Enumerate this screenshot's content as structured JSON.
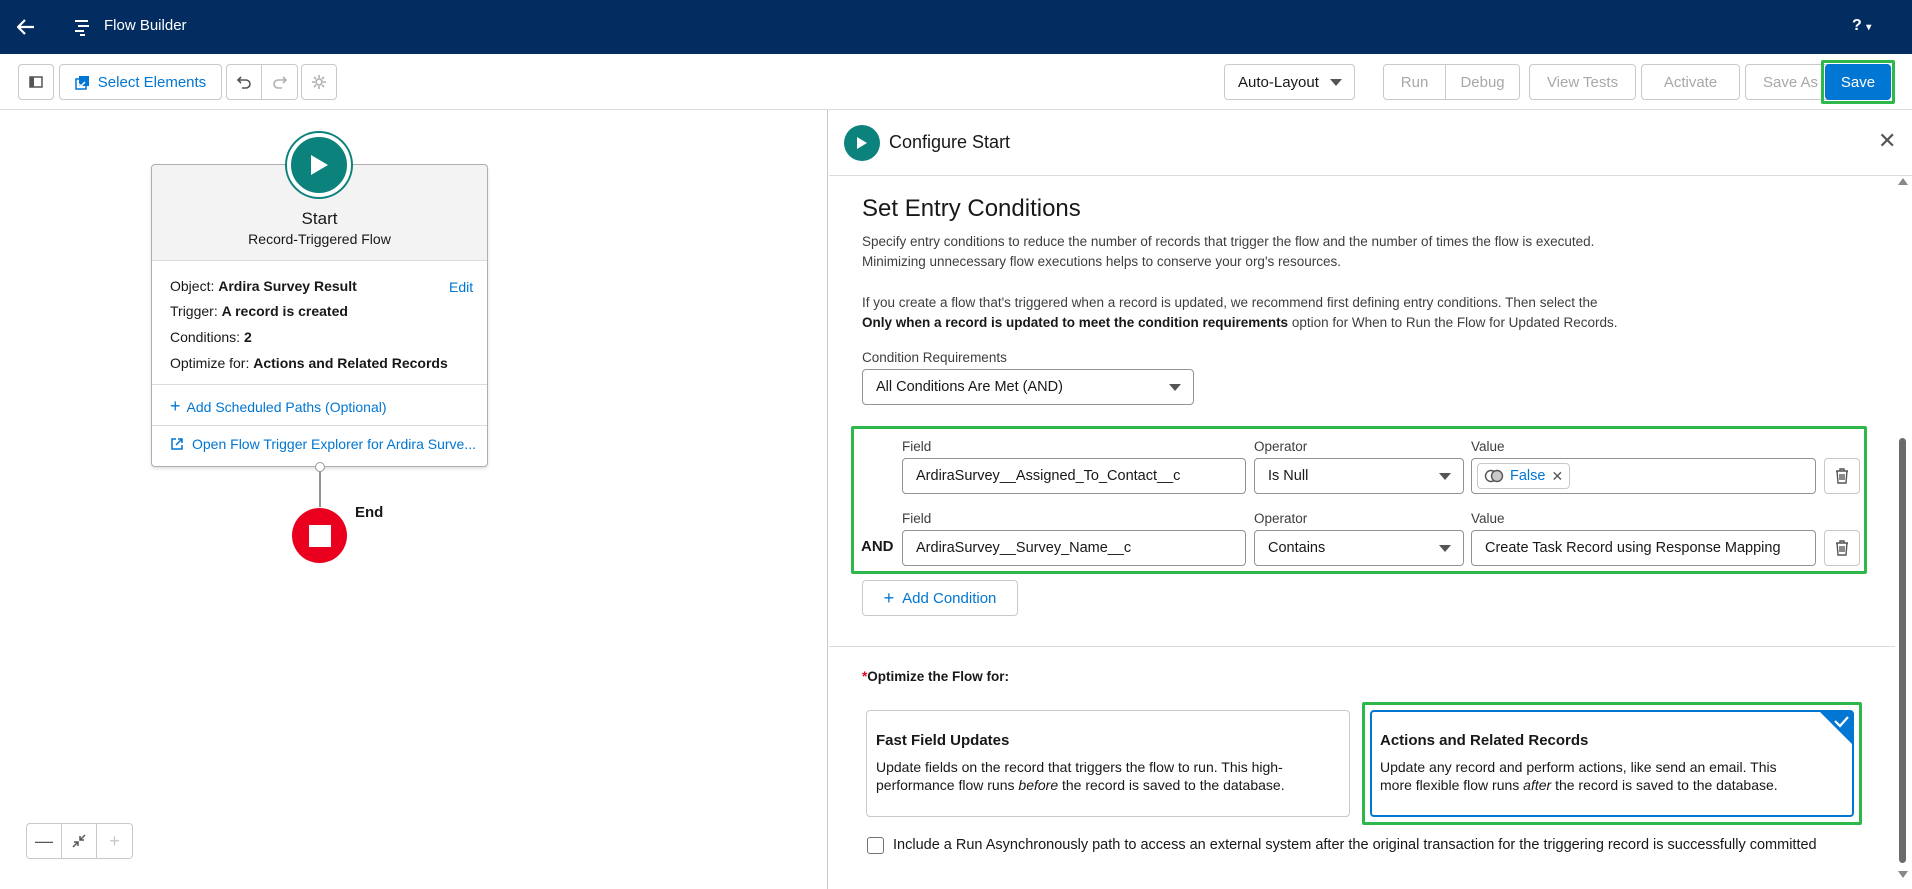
{
  "header": {
    "app_title": "Flow Builder",
    "help": "?"
  },
  "toolbar": {
    "select_elements": "Select Elements",
    "layout_mode": "Auto-Layout",
    "run": "Run",
    "debug": "Debug",
    "view_tests": "View Tests",
    "activate": "Activate",
    "save_as": "Save As",
    "save": "Save"
  },
  "canvas": {
    "start_title": "Start",
    "start_subtitle": "Record-Triggered Flow",
    "object_label": "Object:",
    "object_value": "Ardira Survey Result",
    "edit": "Edit",
    "trigger_label": "Trigger:",
    "trigger_value": "A record is created",
    "conditions_label": "Conditions:",
    "conditions_value": "2",
    "optimize_label": "Optimize for:",
    "optimize_value": "Actions and Related Records",
    "add_scheduled_paths": "Add Scheduled Paths (Optional)",
    "open_trigger_explorer": "Open Flow Trigger Explorer for Ardira Surve...",
    "end_label": "End"
  },
  "panel": {
    "title": "Configure Start",
    "section_title": "Set Entry Conditions",
    "desc_line1": "Specify entry conditions to reduce the number of records that trigger the flow and the number of times the flow is executed.",
    "desc_line2": "Minimizing unnecessary flow executions helps to conserve your org's resources.",
    "desc_line3": "If you create a flow that's triggered when a record is updated, we recommend first defining entry conditions. Then select the",
    "desc_line4_bold": "Only when a record is updated to meet the condition requirements",
    "desc_line4_rest": " option for When to Run the Flow for Updated Records.",
    "condition_requirements_label": "Condition Requirements",
    "condition_requirements_value": "All Conditions Are Met (AND)",
    "field_label": "Field",
    "operator_label": "Operator",
    "value_label": "Value",
    "conditions": [
      {
        "field": "ArdiraSurvey__Assigned_To_Contact__c",
        "operator": "Is Null",
        "value": "False"
      },
      {
        "connector": "AND",
        "field": "ArdiraSurvey__Survey_Name__c",
        "operator": "Contains",
        "value": "Create Task Record using Response Mapping"
      }
    ],
    "add_condition": "Add Condition",
    "optimize_required": "*",
    "optimize_label": "Optimize the Flow for:",
    "fast_title": "Fast Field Updates",
    "fast_body_1": "Update fields on the record that triggers the flow to run. This high-",
    "fast_body_2a": "performance flow runs ",
    "fast_body_2b": "before",
    "fast_body_2c": " the record is saved to the database.",
    "actions_title": "Actions and Related Records",
    "actions_body_1": "Update any record and perform actions, like send an email. This",
    "actions_body_2a": "more flexible flow runs ",
    "actions_body_2b": "after",
    "actions_body_2c": " the record is saved to the database.",
    "async_label": "Include a Run Asynchronously path to access an external system after the original transaction for the triggering record is successfully committed"
  },
  "colors": {
    "header_bg": "#032d60",
    "brand_blue": "#0176d3",
    "start_teal": "#0b827c",
    "end_red": "#ea001e",
    "highlight_green": "#2eb84b"
  }
}
